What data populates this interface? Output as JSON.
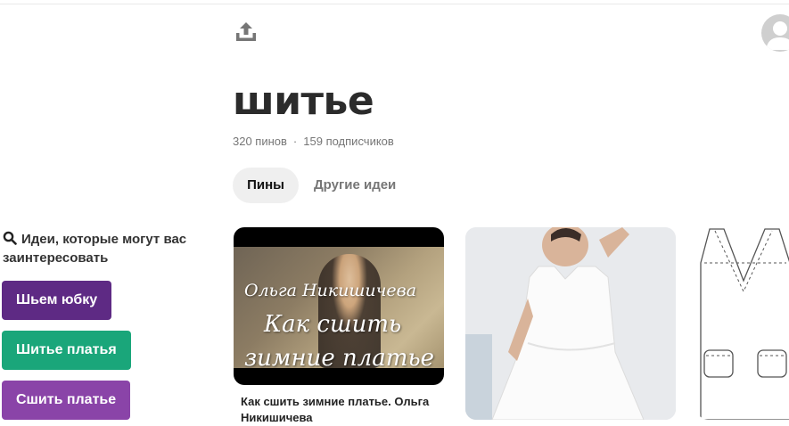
{
  "board": {
    "title": "шитье",
    "pins_count": "320 пинов",
    "separator": "·",
    "followers_count": "159 подписчиков"
  },
  "tabs": [
    {
      "label": "Пины",
      "active": true
    },
    {
      "label": "Другие идеи",
      "active": false
    }
  ],
  "ideas": {
    "heading": "Идеи, которые могут вас заинтересовать",
    "chips": [
      {
        "label": "Шьем юбку",
        "color": "#5e2a84"
      },
      {
        "label": "Шитье платья",
        "color": "#1aa67a"
      },
      {
        "label": "Сшить платье",
        "color": "#8a44a8"
      }
    ]
  },
  "pins": [
    {
      "overlay": [
        "Ольга Никишичева",
        "Как сшить",
        "зимние платье"
      ],
      "title": "Как сшить зимние платье. Ольга Никишичева"
    }
  ],
  "icons": {
    "share": "share-upload-icon",
    "avatar": "user-avatar-icon",
    "search": "search-icon"
  }
}
